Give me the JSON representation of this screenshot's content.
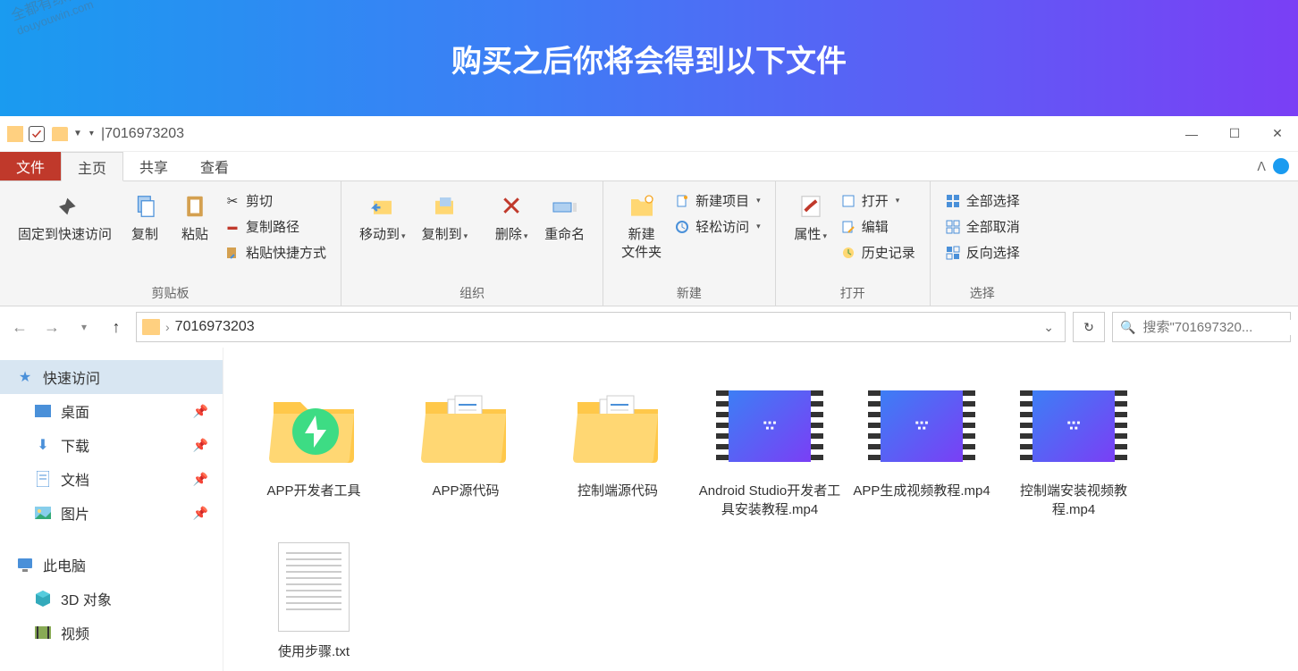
{
  "banner": {
    "title": "购买之后你将会得到以下文件"
  },
  "watermark": {
    "line1": "全都有综合资源网",
    "line2": "douyouwin.com"
  },
  "titlebar": {
    "title": "|7016973203"
  },
  "tabs": {
    "file": "文件",
    "home": "主页",
    "share": "共享",
    "view": "查看"
  },
  "ribbon": {
    "clipboard": {
      "label": "剪贴板",
      "pin": "固定到快速访问",
      "copy": "复制",
      "paste": "粘贴",
      "cut": "剪切",
      "copypath": "复制路径",
      "pasteshortcut": "粘贴快捷方式"
    },
    "organize": {
      "label": "组织",
      "moveto": "移动到",
      "copyto": "复制到",
      "delete": "删除",
      "rename": "重命名"
    },
    "new": {
      "label": "新建",
      "newfolder": "新建\n文件夹",
      "newitem": "新建项目",
      "easyaccess": "轻松访问"
    },
    "open": {
      "label": "打开",
      "properties": "属性",
      "open": "打开",
      "edit": "编辑",
      "history": "历史记录"
    },
    "select": {
      "label": "选择",
      "all": "全部选择",
      "none": "全部取消",
      "invert": "反向选择"
    }
  },
  "addressbar": {
    "path": "7016973203",
    "search_placeholder": "搜索\"701697320..."
  },
  "sidebar": {
    "quickaccess": "快速访问",
    "desktop": "桌面",
    "downloads": "下载",
    "documents": "文档",
    "pictures": "图片",
    "thispc": "此电脑",
    "objects3d": "3D 对象",
    "videos": "视频"
  },
  "files": [
    {
      "type": "folder-app",
      "name": "APP开发者工具"
    },
    {
      "type": "folder-docs",
      "name": "APP源代码"
    },
    {
      "type": "folder-docs",
      "name": "控制端源代码"
    },
    {
      "type": "video",
      "name": "Android Studio开发者工具安装教程.mp4"
    },
    {
      "type": "video",
      "name": "APP生成视频教程.mp4"
    },
    {
      "type": "video",
      "name": "控制端安装视频教程.mp4"
    },
    {
      "type": "txt",
      "name": "使用步骤.txt"
    }
  ]
}
